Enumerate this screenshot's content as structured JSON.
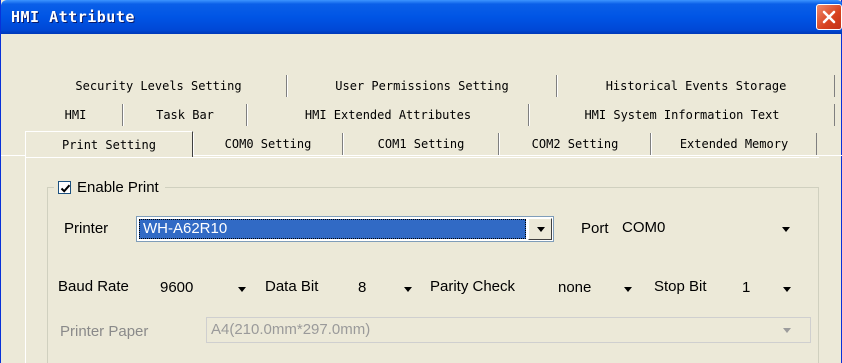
{
  "window": {
    "title": "HMI Attribute"
  },
  "tabs": {
    "row1": [
      "Security Levels Setting",
      "User Permissions Setting",
      "Historical Events Storage"
    ],
    "row2": [
      "HMI",
      "Task Bar",
      "HMI Extended Attributes",
      "HMI System Information Text"
    ],
    "row3": [
      "Print Setting",
      "COM0 Setting",
      "COM1 Setting",
      "COM2 Setting",
      "Extended Memory"
    ],
    "selected": "Print Setting"
  },
  "print": {
    "enable_label": "Enable Print",
    "enable_checked": true,
    "printer_label": "Printer",
    "printer_value": "WH-A62R10",
    "port_label": "Port",
    "port_value": "COM0",
    "baud_label": "Baud Rate",
    "baud_value": "9600",
    "databit_label": "Data Bit",
    "databit_value": "8",
    "parity_label": "Parity Check",
    "parity_value": "none",
    "stopbit_label": "Stop Bit",
    "stopbit_value": "1",
    "paper_label": "Printer Paper",
    "paper_value": "A4(210.0mm*297.0mm)"
  },
  "colors": {
    "titlebar": "#0055e5",
    "dialog_bg": "#ece9d8",
    "selection": "#316ac5",
    "close_button": "#d7421e"
  }
}
